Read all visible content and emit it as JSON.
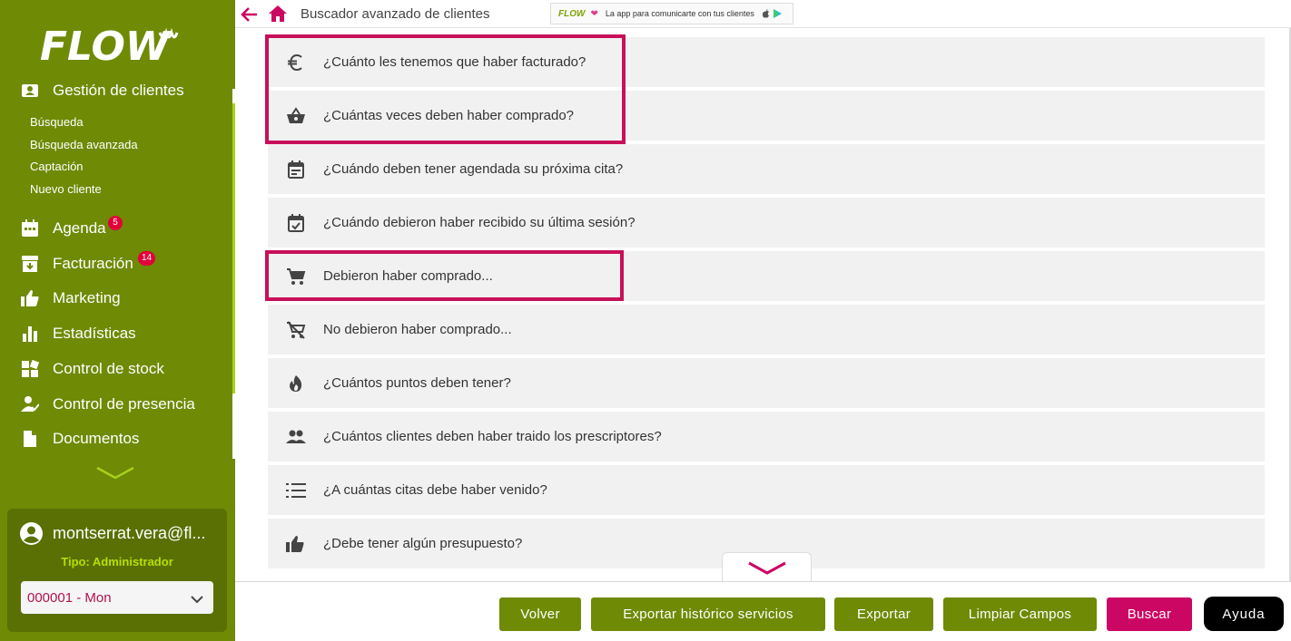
{
  "sidebar": {
    "logo_text": "FLOW",
    "active_section": "Gestión de clientes",
    "sub_items": [
      "Búsqueda",
      "Búsqueda avanzada",
      "Captación",
      "Nuevo cliente"
    ],
    "items": [
      {
        "label": "Agenda",
        "icon": "calendar-icon",
        "badge": "5"
      },
      {
        "label": "Facturación",
        "icon": "invoice-icon",
        "badge": "14"
      },
      {
        "label": "Marketing",
        "icon": "thumbs-up-icon",
        "badge": ""
      },
      {
        "label": "Estadísticas",
        "icon": "bar-chart-icon",
        "badge": ""
      },
      {
        "label": "Control de stock",
        "icon": "stock-icon",
        "badge": ""
      },
      {
        "label": "Control de presencia",
        "icon": "person-check-icon",
        "badge": ""
      },
      {
        "label": "Documentos",
        "icon": "document-icon",
        "badge": ""
      }
    ],
    "user": {
      "email": "montserrat.vera@fl...",
      "type": "Tipo: Administrador",
      "center": "000001 - Mon"
    }
  },
  "topbar": {
    "title": "Buscador avanzado de clientes",
    "promo": {
      "brand": "FLOW",
      "text": "La app para comunicarte con tus clientes"
    }
  },
  "questions": [
    {
      "label": "¿Cuánto les tenemos que haber facturado?",
      "icon": "euro-icon",
      "highlighted": true
    },
    {
      "label": "¿Cuántas veces deben haber comprado?",
      "icon": "basket-icon",
      "highlighted": true
    },
    {
      "label": "¿Cuándo deben tener agendada su próxima cita?",
      "icon": "calendar-icon",
      "highlighted": false
    },
    {
      "label": "¿Cuándo debieron haber recibido su última sesión?",
      "icon": "calendar-check-icon",
      "highlighted": false
    },
    {
      "label": "Debieron haber comprado...",
      "icon": "cart-icon",
      "highlighted": true
    },
    {
      "label": "No debieron haber comprado...",
      "icon": "cart-off-icon",
      "highlighted": false
    },
    {
      "label": "¿Cuántos puntos deben tener?",
      "icon": "flame-icon",
      "highlighted": false
    },
    {
      "label": "¿Cuántos clientes deben haber traido los prescriptores?",
      "icon": "people-icon",
      "highlighted": false
    },
    {
      "label": "¿A cuántas citas debe haber venido?",
      "icon": "numbered-list-icon",
      "highlighted": false
    },
    {
      "label": "¿Debe tener algún presupuesto?",
      "icon": "thumbs-up-icon",
      "highlighted": false
    }
  ],
  "actions": {
    "volver": "Volver",
    "exportar_historico": "Exportar histórico servicios",
    "exportar": "Exportar",
    "limpiar": "Limpiar Campos",
    "buscar": "Buscar",
    "ayuda": "Ayuda"
  },
  "colors": {
    "sidebar_green": "#6f8a05",
    "accent_pink": "#cc0763",
    "highlight_border": "#c8105a",
    "badge_red": "#e2003b",
    "row_bg": "#f1f1f1"
  }
}
